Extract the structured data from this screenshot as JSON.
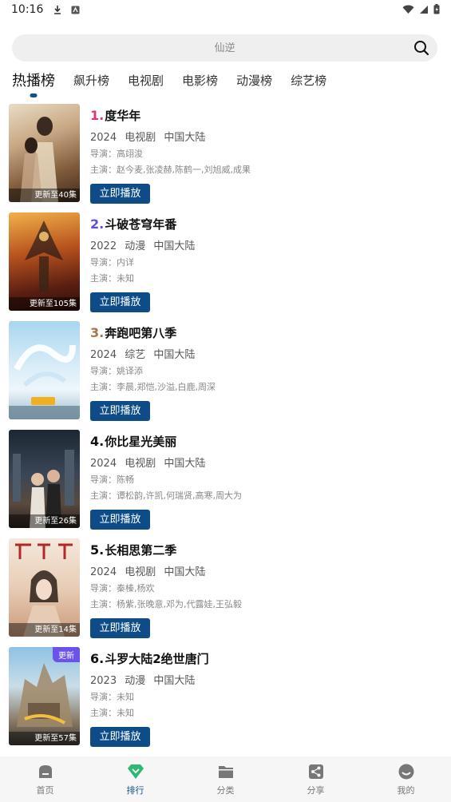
{
  "status": {
    "time": "10:16"
  },
  "search": {
    "placeholder": "仙逆"
  },
  "tabs": [
    {
      "label": "热播榜",
      "active": true
    },
    {
      "label": "飙升榜"
    },
    {
      "label": "电视剧"
    },
    {
      "label": "电影榜"
    },
    {
      "label": "动漫榜"
    },
    {
      "label": "综艺榜"
    }
  ],
  "colors": {
    "accent": "#0e4c88",
    "rank1": "#e0337a",
    "rank2": "#5b4fe0",
    "rank3": "#a0784a",
    "badge": "#6b52e8"
  },
  "items": [
    {
      "rank": "1.",
      "title": "度华年",
      "year": "2024",
      "type": "电视剧",
      "region": "中国大陆",
      "director": "导演：高翊浚",
      "cast": "主演：赵今麦,张凌赫,陈鹤一,刘旭威,成果",
      "update": "更新至40集",
      "play": "立即播放"
    },
    {
      "rank": "2.",
      "title": "斗破苍穹年番",
      "year": "2022",
      "type": "动漫",
      "region": "中国大陆",
      "director": "导演：内详",
      "cast": "主演：未知",
      "update": "更新至105集",
      "play": "立即播放"
    },
    {
      "rank": "3.",
      "title": "奔跑吧第八季",
      "year": "2024",
      "type": "综艺",
      "region": "中国大陆",
      "director": "导演：姚译添",
      "cast": "主演：李晨,郑恺,沙溢,白鹿,周深",
      "update": "",
      "play": "立即播放"
    },
    {
      "rank": "4.",
      "title": "你比星光美丽",
      "year": "2024",
      "type": "电视剧",
      "region": "中国大陆",
      "director": "导演：陈畅",
      "cast": "主演：谭松韵,许凯,何瑞贤,高寒,周大为",
      "update": "更新至26集",
      "play": "立即播放"
    },
    {
      "rank": "5.",
      "title": "长相思第二季",
      "year": "2024",
      "type": "电视剧",
      "region": "中国大陆",
      "director": "导演：秦榛,杨欢",
      "cast": "主演：杨紫,张晚意,邓为,代露娃,王弘毅",
      "update": "更新至14集",
      "play": "立即播放"
    },
    {
      "rank": "6.",
      "title": "斗罗大陆2绝世唐门",
      "year": "2023",
      "type": "动漫",
      "region": "中国大陆",
      "director": "导演：未知",
      "cast": "主演：未知",
      "update": "更新至57集",
      "badge": "更新",
      "play": "立即播放"
    }
  ],
  "nav": [
    {
      "label": "首页",
      "icon": "home-icon"
    },
    {
      "label": "排行",
      "icon": "ranking-icon",
      "active": true
    },
    {
      "label": "分类",
      "icon": "folder-icon"
    },
    {
      "label": "分享",
      "icon": "share-icon"
    },
    {
      "label": "我的",
      "icon": "profile-icon"
    }
  ]
}
